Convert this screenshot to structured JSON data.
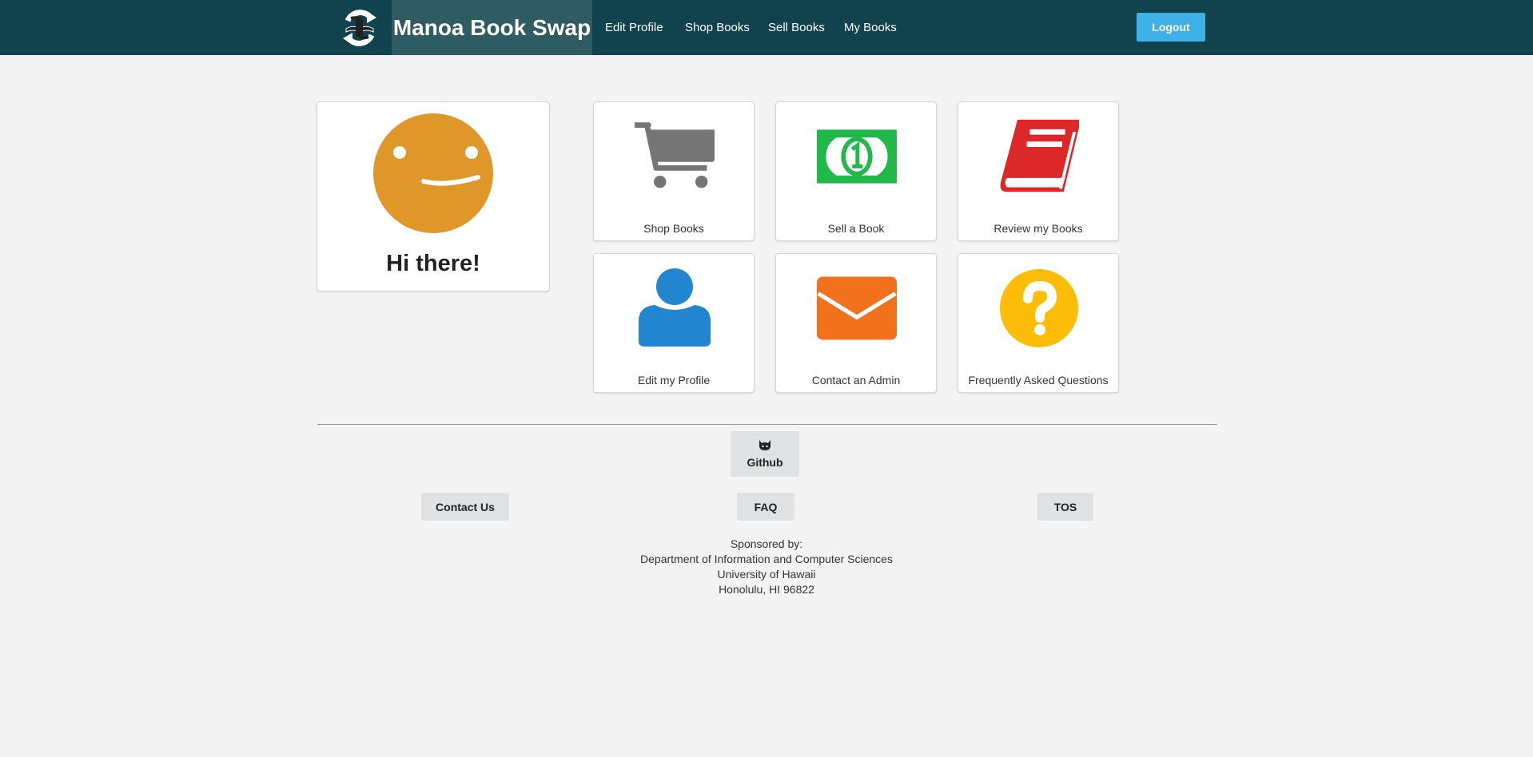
{
  "navbar": {
    "brand": "Manoa Book Swap",
    "links": [
      "Edit Profile",
      "Shop Books",
      "Sell Books",
      "My Books"
    ],
    "logout_label": "Logout",
    "background_color": "#10434e",
    "accent_color": "#3fb1e6"
  },
  "greeting": {
    "text": "Hi there!",
    "icon": "smiley-face-icon",
    "color": "#e0972a"
  },
  "tiles": [
    {
      "label": "Shop Books",
      "icon": "shopping-cart-icon",
      "color": "#757575"
    },
    {
      "label": "Sell a Book",
      "icon": "dollar-bill-icon",
      "color": "#21b84a"
    },
    {
      "label": "Review my Books",
      "icon": "book-icon",
      "color": "#dc2828"
    },
    {
      "label": "Edit my Profile",
      "icon": "user-icon",
      "color": "#2185d0"
    },
    {
      "label": "Contact an Admin",
      "icon": "envelope-icon",
      "color": "#f2711c"
    },
    {
      "label": "Frequently Asked Questions",
      "icon": "question-circle-icon",
      "color": "#fbbd08"
    }
  ],
  "footer": {
    "github_label": "Github",
    "contact_label": "Contact Us",
    "faq_label": "FAQ",
    "tos_label": "TOS",
    "sponsor_lines": [
      "Sponsored by:",
      "Department of Information and Computer Sciences",
      "University of Hawaii",
      "Honolulu, HI 96822"
    ]
  }
}
